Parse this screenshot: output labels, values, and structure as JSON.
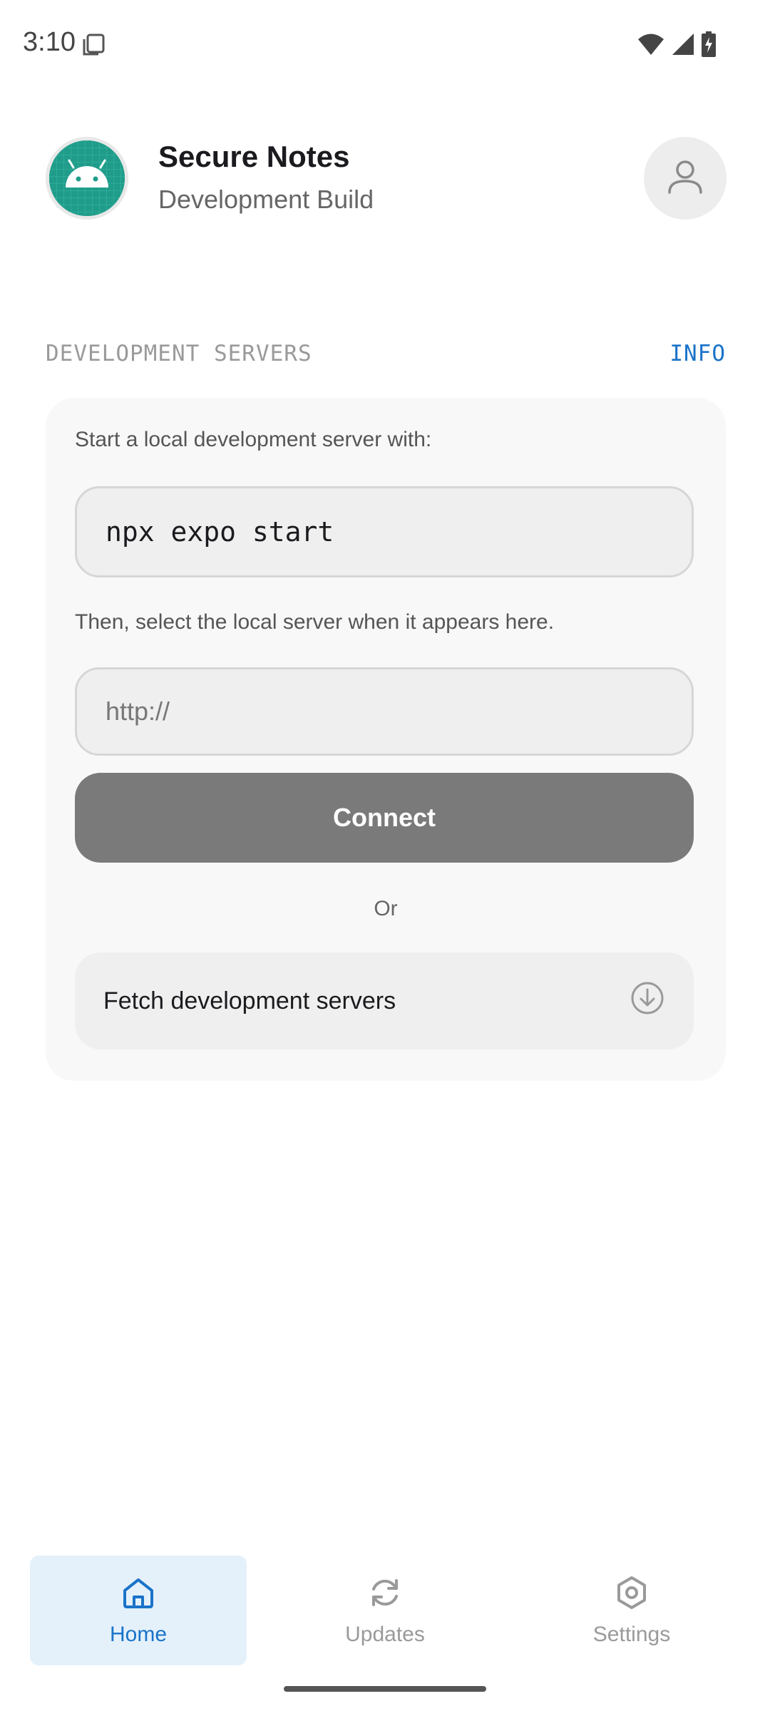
{
  "status_bar": {
    "time": "3:10",
    "icons": [
      "notification-copy-icon",
      "wifi-icon",
      "signal-icon",
      "battery-charging-icon"
    ]
  },
  "header": {
    "app_name": "Secure Notes",
    "build_type": "Development Build",
    "app_icon": "android-icon",
    "profile_icon": "user-icon"
  },
  "section": {
    "title": "DEVELOPMENT SERVERS",
    "info_label": "INFO"
  },
  "card": {
    "intro_text": "Start a local development server with:",
    "command": "npx expo start",
    "select_text": "Then, select the local server when it appears here.",
    "url_placeholder": "http://",
    "connect_label": "Connect",
    "or_text": "Or",
    "fetch_label": "Fetch development servers",
    "fetch_icon": "download-circle-icon"
  },
  "bottom_nav": {
    "items": [
      {
        "label": "Home",
        "icon": "home-icon",
        "active": true
      },
      {
        "label": "Updates",
        "icon": "refresh-icon",
        "active": false
      },
      {
        "label": "Settings",
        "icon": "settings-icon",
        "active": false
      }
    ]
  },
  "colors": {
    "accent": "#1a73c9",
    "active_nav_bg": "#e4f1fb",
    "connect_button": "#7a7a7a",
    "app_icon_bg": "#1f9d8a"
  }
}
